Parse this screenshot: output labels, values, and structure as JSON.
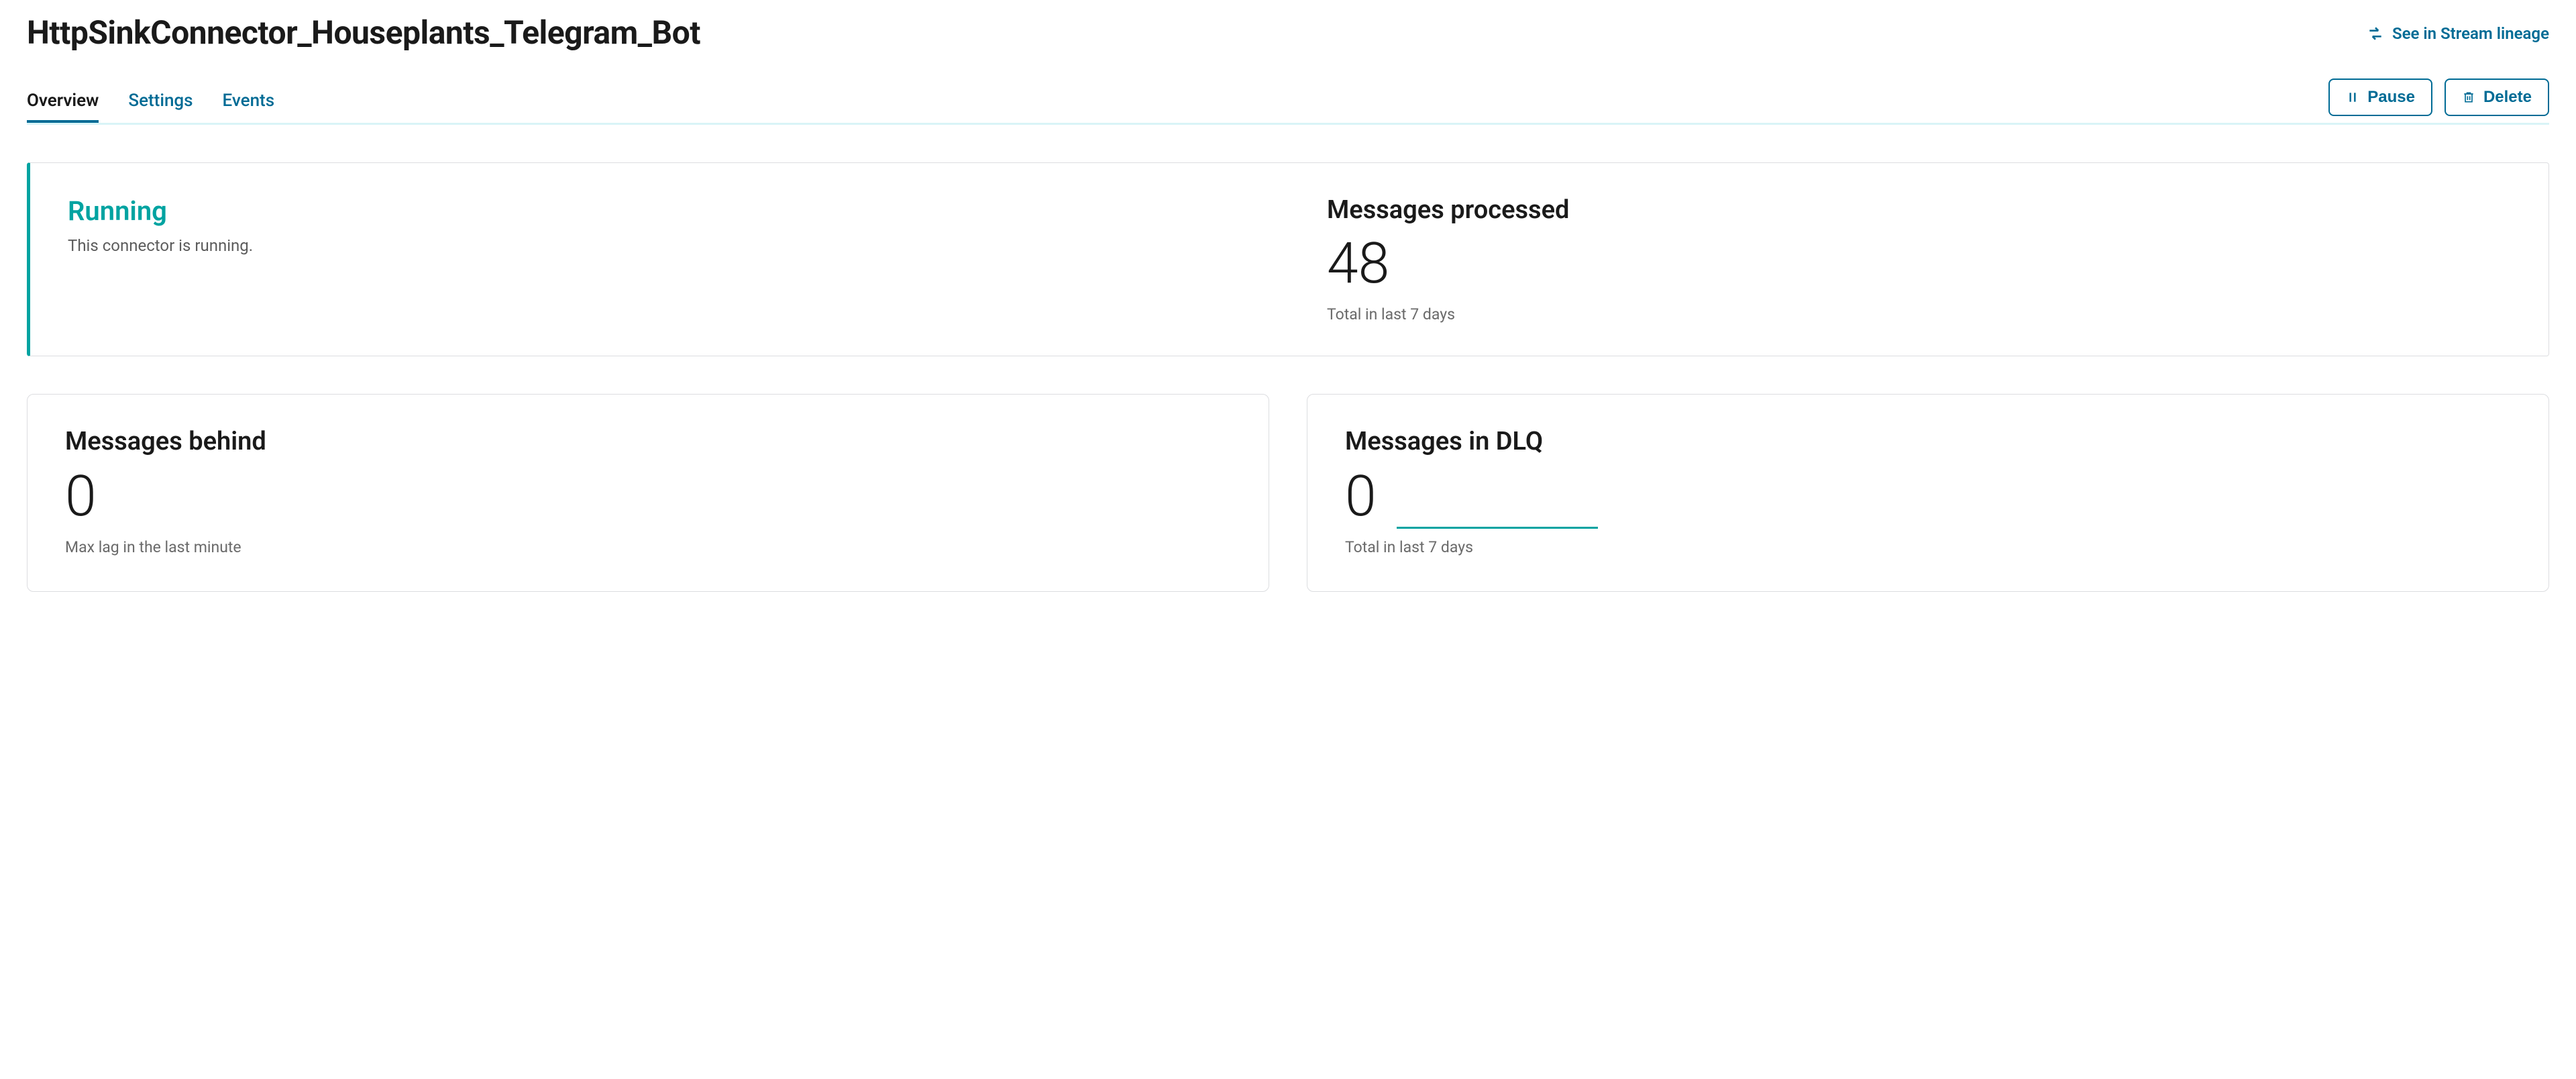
{
  "title": "HttpSinkConnector_Houseplants_Telegram_Bot",
  "lineage_link": "See in Stream lineage",
  "tabs": {
    "overview": "Overview",
    "settings": "Settings",
    "events": "Events"
  },
  "actions": {
    "pause": "Pause",
    "delete": "Delete"
  },
  "status": {
    "label": "Running",
    "desc": "This connector is running."
  },
  "processed": {
    "title": "Messages processed",
    "value": "48",
    "caption": "Total in last 7 days"
  },
  "behind": {
    "title": "Messages behind",
    "value": "0",
    "caption": "Max lag in the last minute"
  },
  "dlq": {
    "title": "Messages in DLQ",
    "value": "0",
    "caption": "Total in last 7 days"
  }
}
